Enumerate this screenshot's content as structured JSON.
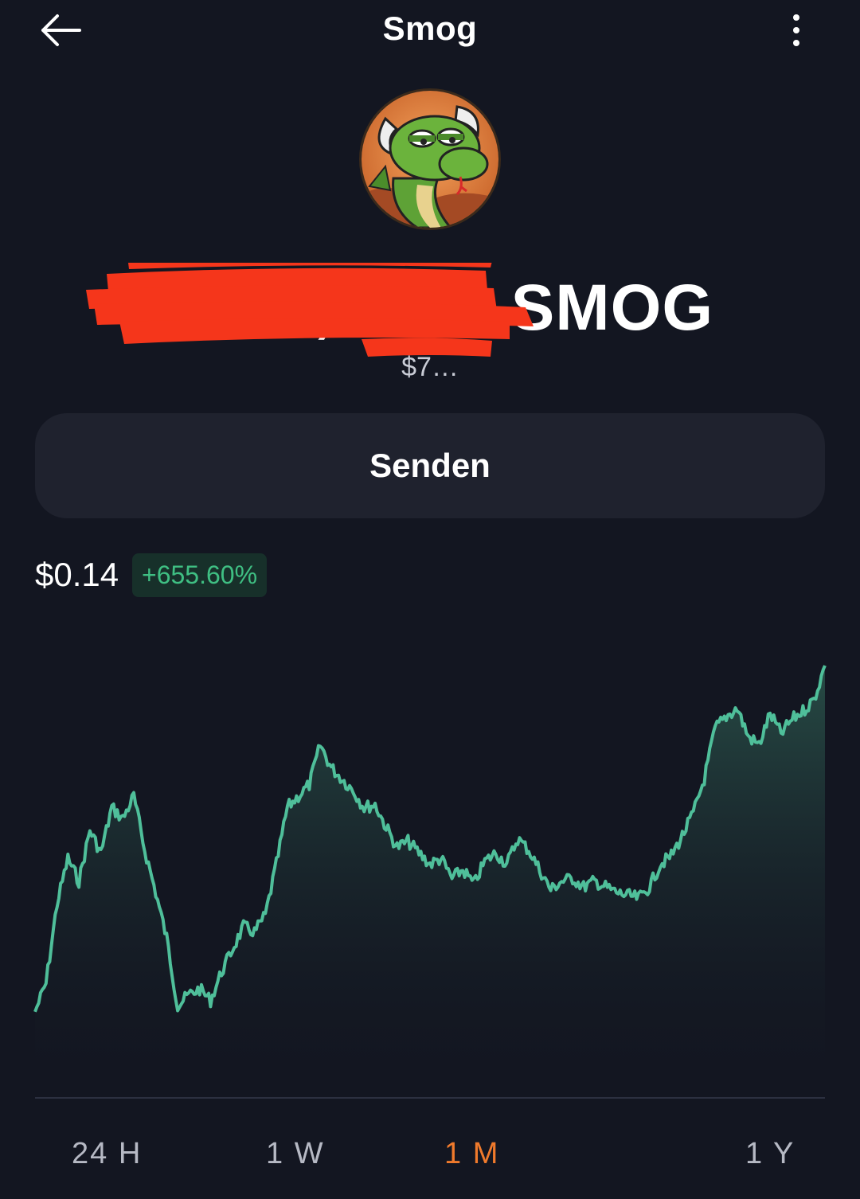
{
  "header": {
    "title": "Smog",
    "back_icon": "arrow-left-icon",
    "more_icon": "more-vertical-icon"
  },
  "token": {
    "avatar_icon": "smog-dragon-logo",
    "balance_text": "4,974,… 62 SMOG",
    "balance_usd": "$7…",
    "redaction_color": "#f5361b"
  },
  "actions": {
    "send_label": "Senden"
  },
  "price": {
    "value": "$0.14",
    "change": "+655.60%",
    "change_color": "#3fbf83"
  },
  "chart_data": {
    "type": "area",
    "line_color": "#4fbf9a",
    "values": [
      0.018,
      0.028,
      0.056,
      0.072,
      0.064,
      0.082,
      0.074,
      0.09,
      0.086,
      0.094,
      0.075,
      0.06,
      0.044,
      0.02,
      0.024,
      0.026,
      0.022,
      0.032,
      0.04,
      0.048,
      0.046,
      0.052,
      0.07,
      0.09,
      0.094,
      0.098,
      0.112,
      0.104,
      0.1,
      0.096,
      0.09,
      0.091,
      0.083,
      0.076,
      0.078,
      0.074,
      0.07,
      0.072,
      0.065,
      0.068,
      0.063,
      0.071,
      0.074,
      0.07,
      0.079,
      0.075,
      0.068,
      0.061,
      0.064,
      0.065,
      0.062,
      0.064,
      0.062,
      0.06,
      0.059,
      0.058,
      0.062,
      0.07,
      0.073,
      0.08,
      0.088,
      0.1,
      0.118,
      0.122,
      0.125,
      0.115,
      0.112,
      0.123,
      0.116,
      0.121,
      0.124,
      0.128,
      0.14
    ],
    "range_selected": "1 M"
  },
  "range_tabs": [
    {
      "label": "24 H",
      "active": false
    },
    {
      "label": "1 W",
      "active": false
    },
    {
      "label": "1 M",
      "active": true
    },
    {
      "label": "1 Y",
      "active": false
    }
  ]
}
